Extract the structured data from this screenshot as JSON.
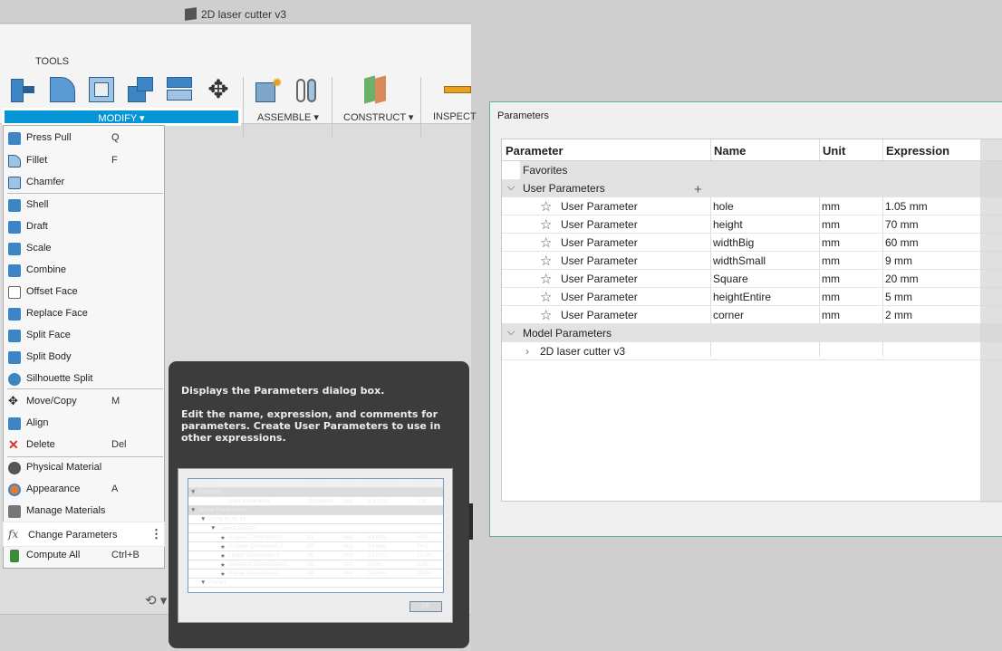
{
  "document": {
    "title": "2D laser cutter v3"
  },
  "toolbar": {
    "tools_label": "TOOLS",
    "modify_label": "MODIFY ▾",
    "assemble_label": "ASSEMBLE ▾",
    "construct_label": "CONSTRUCT ▾",
    "inspect_label": "INSPECT"
  },
  "menu": {
    "items": [
      {
        "label": "Press Pull",
        "shortcut": "Q",
        "icon": "press-pull-icon",
        "color": "#3d86c6"
      },
      {
        "label": "Fillet",
        "shortcut": "F",
        "icon": "fillet-icon",
        "color": "#5b9bd5"
      },
      {
        "label": "Chamfer",
        "shortcut": "",
        "icon": "chamfer-icon",
        "color": "#5b9bd5"
      },
      {
        "label": "Shell",
        "shortcut": "",
        "icon": "shell-icon",
        "color": "#3d86c6"
      },
      {
        "label": "Draft",
        "shortcut": "",
        "icon": "draft-icon",
        "color": "#3d86c6"
      },
      {
        "label": "Scale",
        "shortcut": "",
        "icon": "scale-icon",
        "color": "#3d86c6"
      },
      {
        "label": "Combine",
        "shortcut": "",
        "icon": "combine-icon",
        "color": "#3d86c6"
      },
      {
        "label": "Offset Face",
        "shortcut": "",
        "icon": "offset-face-icon",
        "color": "#888888"
      },
      {
        "label": "Replace Face",
        "shortcut": "",
        "icon": "replace-face-icon",
        "color": "#3d86c6"
      },
      {
        "label": "Split Face",
        "shortcut": "",
        "icon": "split-face-icon",
        "color": "#3d86c6"
      },
      {
        "label": "Split Body",
        "shortcut": "",
        "icon": "split-body-icon",
        "color": "#3d86c6"
      },
      {
        "label": "Silhouette Split",
        "shortcut": "",
        "icon": "silhouette-split-icon",
        "color": "#3d86c6"
      },
      {
        "label": "Move/Copy",
        "shortcut": "M",
        "icon": "move-icon",
        "color": "#444444"
      },
      {
        "label": "Align",
        "shortcut": "",
        "icon": "align-icon",
        "color": "#3d86c6"
      },
      {
        "label": "Delete",
        "shortcut": "Del",
        "icon": "delete-icon",
        "color": "#d9302b"
      },
      {
        "label": "Physical Material",
        "shortcut": "",
        "icon": "physical-material-icon",
        "color": "#555555"
      },
      {
        "label": "Appearance",
        "shortcut": "A",
        "icon": "appearance-icon",
        "color": "#e07a2e"
      },
      {
        "label": "Manage Materials",
        "shortcut": "",
        "icon": "manage-materials-icon",
        "color": "#555555"
      },
      {
        "label": "Change Parameters",
        "shortcut": "",
        "icon": "fx-icon",
        "color": "#666666"
      },
      {
        "label": "Compute All",
        "shortcut": "Ctrl+B",
        "icon": "compute-all-icon",
        "color": "#3a8d3a"
      }
    ],
    "more_icon": "more-vertical-icon"
  },
  "tooltip": {
    "title": "Displays the Parameters dialog box.",
    "description": "Edit the name, expression, and comments for parameters. Create User Parameters to use in other expressions.",
    "preview": {
      "headers": [
        "Parameter",
        "Name",
        "Unit",
        "Expression",
        "Value"
      ],
      "rows": [
        {
          "label": "Favorites",
          "name": "",
          "unit": "",
          "expr": "",
          "value": "",
          "indent": 0,
          "group": true,
          "mark": "▼"
        },
        {
          "label": "User Parameter",
          "name": "Thickness",
          "unit": "mm",
          "expr": "1.5 mm",
          "value": "1.50",
          "indent": 3,
          "group": false,
          "mark": ""
        },
        {
          "label": "Model Parameters",
          "name": "",
          "unit": "",
          "expr": "",
          "value": "",
          "indent": 0,
          "group": true,
          "mark": "▼"
        },
        {
          "label": "Utility Knife v1",
          "name": "",
          "unit": "",
          "expr": "",
          "value": "",
          "indent": 1,
          "group": false,
          "mark": "▼"
        },
        {
          "label": "Layout Sketch",
          "name": "",
          "unit": "",
          "expr": "",
          "value": "",
          "indent": 2,
          "group": false,
          "mark": "▼"
        },
        {
          "label": "Angular Dimension-2",
          "name": "d1",
          "unit": "deg",
          "expr": "63 deg",
          "value": "63.0",
          "indent": 3,
          "group": false,
          "mark": "★"
        },
        {
          "label": "Angular Dimension-3",
          "name": "d3",
          "unit": "deg",
          "expr": "54 deg",
          "value": "54.0",
          "indent": 3,
          "group": false,
          "mark": "★"
        },
        {
          "label": "Linear Dimension-2",
          "name": "d5",
          "unit": "mm",
          "expr": "17 mm",
          "value": "17.00",
          "indent": 3,
          "group": false,
          "mark": "★"
        },
        {
          "label": "Diameter Dimension-2",
          "name": "d6",
          "unit": "mm",
          "expr": "5 mm",
          "value": "5.00",
          "indent": 3,
          "group": false,
          "mark": "★"
        },
        {
          "label": "Radial Dimension-2",
          "name": "d8",
          "unit": "mm",
          "expr": "20 mm",
          "value": "20.00",
          "indent": 3,
          "group": false,
          "mark": "★"
        },
        {
          "label": "Plane1",
          "name": "",
          "unit": "",
          "expr": "",
          "value": "",
          "indent": 1,
          "group": false,
          "mark": "▼"
        }
      ],
      "ok_label": "OK"
    }
  },
  "parameters_dialog": {
    "title": "Parameters",
    "headers": {
      "parameter": "Parameter",
      "name": "Name",
      "unit": "Unit",
      "expression": "Expression"
    },
    "favorites_label": "Favorites",
    "user_group_label": "User Parameters",
    "user_params": [
      {
        "label": "User Parameter",
        "name": "hole",
        "unit": "mm",
        "expression": "1.05 mm"
      },
      {
        "label": "User Parameter",
        "name": "height",
        "unit": "mm",
        "expression": "70 mm"
      },
      {
        "label": "User Parameter",
        "name": "widthBig",
        "unit": "mm",
        "expression": "60 mm"
      },
      {
        "label": "User Parameter",
        "name": "widthSmall",
        "unit": "mm",
        "expression": "9 mm"
      },
      {
        "label": "User Parameter",
        "name": "Square",
        "unit": "mm",
        "expression": "20 mm"
      },
      {
        "label": "User Parameter",
        "name": "heightEntire",
        "unit": "mm",
        "expression": "5 mm"
      },
      {
        "label": "User Parameter",
        "name": "corner",
        "unit": "mm",
        "expression": "2 mm"
      }
    ],
    "model_group_label": "Model Parameters",
    "model_child_label": "2D laser cutter v3"
  }
}
